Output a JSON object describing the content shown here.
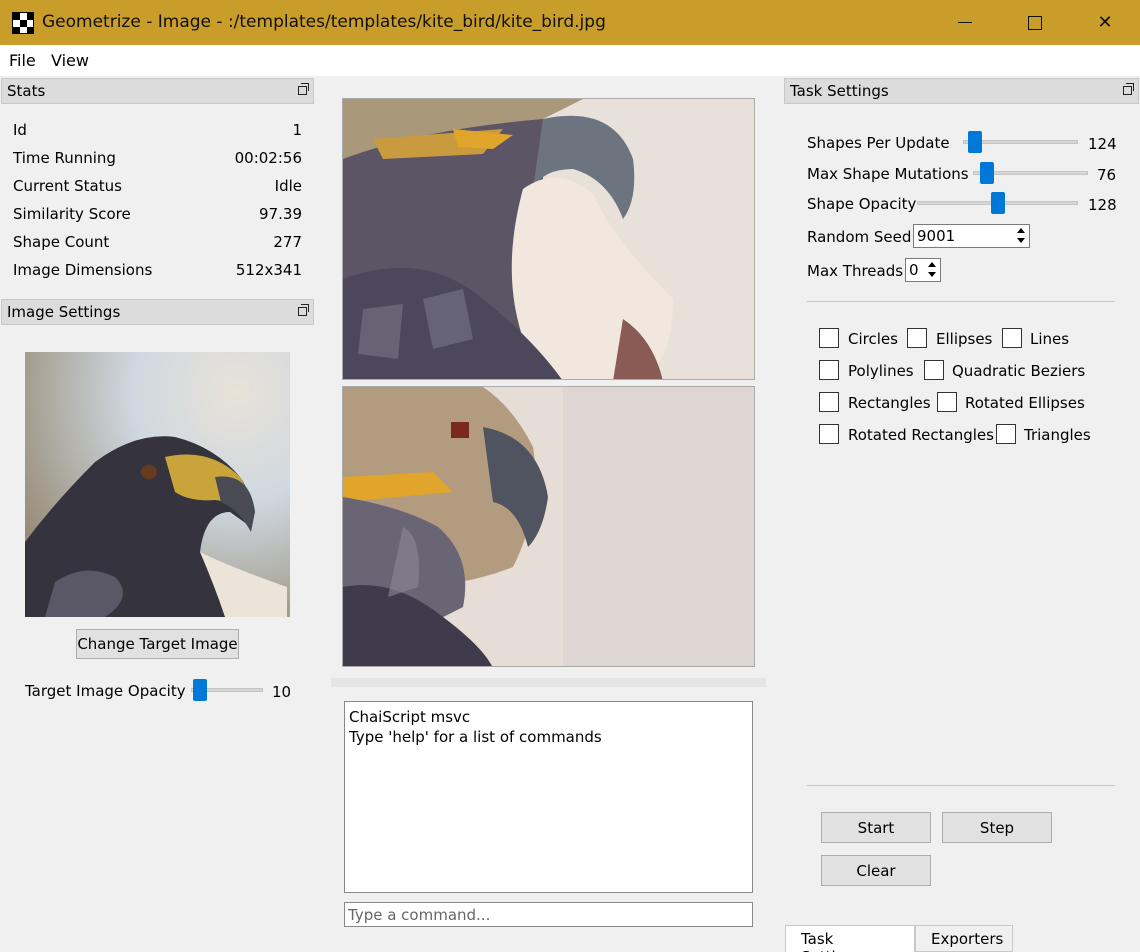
{
  "window": {
    "title": "Geometrize - Image - :/templates/templates/kite_bird/kite_bird.jpg",
    "minimize_icon": "minimize-icon",
    "maximize_icon": "maximize-icon",
    "close_icon": "close-icon",
    "close_glyph": "✕"
  },
  "menu": {
    "items": [
      "File",
      "View"
    ]
  },
  "stats": {
    "header": "Stats",
    "rows": [
      {
        "label": "Id",
        "value": "1"
      },
      {
        "label": "Time Running",
        "value": "00:02:56"
      },
      {
        "label": "Current Status",
        "value": "Idle"
      },
      {
        "label": "Similarity Score",
        "value": "97.39"
      },
      {
        "label": "Shape Count",
        "value": "277"
      },
      {
        "label": "Image Dimensions",
        "value": "512x341"
      }
    ]
  },
  "image_settings": {
    "header": "Image Settings",
    "change_button": "Change Target Image",
    "opacity_label": "Target Image Opacity",
    "opacity_value": "10",
    "opacity_fraction": 0.04
  },
  "console": {
    "lines": [
      "ChaiScript msvc",
      "Type 'help' for a list of commands"
    ],
    "placeholder": "Type a command..."
  },
  "task_settings": {
    "header": "Task Settings",
    "sliders": [
      {
        "label": "Shapes Per Update",
        "value": "124",
        "fraction": 0.05
      },
      {
        "label": "Max Shape Mutations",
        "value": "76",
        "fraction": 0.07
      },
      {
        "label": "Shape Opacity",
        "value": "128",
        "fraction": 0.5
      }
    ],
    "random_seed_label": "Random Seed",
    "random_seed_value": "9001",
    "max_threads_label": "Max Threads",
    "max_threads_value": "0",
    "shape_types": [
      {
        "label": "Circles",
        "checked": false
      },
      {
        "label": "Ellipses",
        "checked": false
      },
      {
        "label": "Lines",
        "checked": false
      },
      {
        "label": "Polylines",
        "checked": false
      },
      {
        "label": "Quadratic Beziers",
        "checked": false
      },
      {
        "label": "Rectangles",
        "checked": false
      },
      {
        "label": "Rotated Ellipses",
        "checked": false
      },
      {
        "label": "Rotated Rectangles",
        "checked": false
      },
      {
        "label": "Triangles",
        "checked": false
      }
    ],
    "buttons": {
      "start": "Start",
      "step": "Step",
      "clear": "Clear"
    }
  },
  "tabs": [
    {
      "label": "Task Settings",
      "active": true
    },
    {
      "label": "Exporters",
      "active": false
    }
  ],
  "colors": {
    "titlebar": "#c99d2a",
    "slider_thumb": "#0078d7"
  }
}
